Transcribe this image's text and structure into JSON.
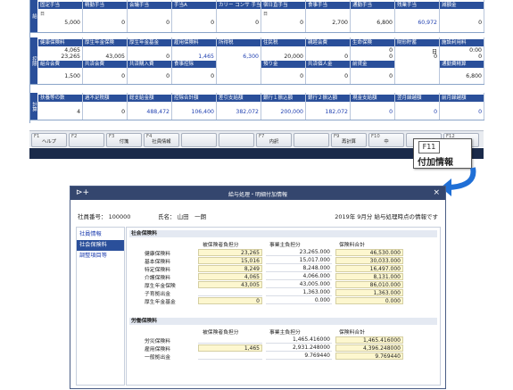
{
  "top_grid": {
    "row1": {
      "side": "給",
      "headers": [
        "固定手当",
        "精勤手当",
        "会議手当",
        "手当A",
        "カリー コンサ 手当",
        "宿日直手当",
        "食事手当",
        "通勤手当",
        "残業手当",
        "減額金"
      ],
      "marks": [
        "日",
        "",
        "",
        "",
        "",
        "日",
        "",
        "",
        "",
        ""
      ],
      "values": [
        "5,000",
        "0",
        "0",
        "0",
        "0",
        "0",
        "2,700",
        "6,800",
        "60,972",
        "0"
      ],
      "blue": [
        false,
        false,
        false,
        false,
        false,
        false,
        false,
        false,
        true,
        false
      ]
    },
    "row2": {
      "side": "控除",
      "headers": [
        "健康保険料",
        "厚生年金保険",
        "厚生年金基金",
        "雇用保険料",
        "所得税",
        "住民税",
        "親睦会費",
        "生命保険",
        "財形貯蓄",
        "施設利用料"
      ],
      "values_top": [
        "4,065",
        "",
        "",
        "",
        "",
        "",
        "",
        "0",
        "日",
        "0:00"
      ],
      "values": [
        "23,265",
        "43,005",
        "0",
        "1,465",
        "6,300",
        "20,000",
        "0",
        "0",
        "0",
        "0"
      ],
      "blue": [
        false,
        false,
        false,
        true,
        true,
        false,
        false,
        false,
        false,
        false
      ],
      "headers2": [
        "組合会費",
        "共済会費",
        "共済購入費",
        "食事控除",
        "",
        "預り金",
        "共済個人金",
        "前貸金",
        "",
        "通勤費精算"
      ],
      "values2": [
        "1,500",
        "0",
        "0",
        "0",
        "",
        "0",
        "0",
        "0",
        "",
        "6,800"
      ]
    },
    "row3": {
      "side": "計算",
      "headers": [
        "扶養等の数",
        "過不足税額",
        "総支給金額",
        "控除合計額",
        "差引支給額",
        "銀行１振込額",
        "銀行２振込額",
        "現金支給額",
        "翌月繰越額",
        "前月繰越額"
      ],
      "values": [
        "4",
        "0",
        "488,472",
        "106,400",
        "382,072",
        "200,000",
        "182,072",
        "0",
        "0",
        "0"
      ],
      "blue": [
        false,
        false,
        true,
        true,
        true,
        true,
        true,
        true,
        true,
        true
      ]
    }
  },
  "fkeys": [
    {
      "num": "F1",
      "label": "ヘルプ"
    },
    {
      "num": "F2",
      "label": ""
    },
    {
      "num": "F3",
      "label": "付箋"
    },
    {
      "num": "F4",
      "label": "社員情報"
    },
    {
      "num": "",
      "label": ""
    },
    {
      "num": "",
      "label": ""
    },
    {
      "num": "F7",
      "label": "内訳"
    },
    {
      "num": "",
      "label": ""
    },
    {
      "num": "F9",
      "label": "再計算"
    },
    {
      "num": "F10",
      "label": "中"
    },
    {
      "num": "",
      "label": ""
    },
    {
      "num": "F12",
      "label": "む"
    }
  ],
  "callout": {
    "key": "F11",
    "text": "付加情報"
  },
  "dialog": {
    "title": "給与処理・明細付加情報",
    "employee_no_label": "社員番号：",
    "employee_no": "100000",
    "name_label": "氏名：",
    "name": "山田　一朗",
    "period_note": "2019年 9月分 給与処理時点の情報です",
    "sidebar": [
      "社員情報",
      "社会保険料",
      "調整項目等"
    ],
    "social": {
      "title": "社会保険料",
      "cols": [
        "被保険者負担分",
        "事業主負担分",
        "保険料合計"
      ],
      "rows": [
        {
          "label": "健康保険料",
          "a": "23,265",
          "b": "23,265.000",
          "c": "46,530.000"
        },
        {
          "label": "基本保険料",
          "a": "15,016",
          "b": "15,017.000",
          "c": "30,033.000"
        },
        {
          "label": "特定保険料",
          "a": "8,249",
          "b": "8,248.000",
          "c": "16,497.000"
        },
        {
          "label": "介護保険料",
          "a": "4,065",
          "b": "4,066.000",
          "c": "8,131.000"
        },
        {
          "label": "厚生年金保険",
          "a": "43,005",
          "b": "43,005.000",
          "c": "86,010.000"
        },
        {
          "label": "子育拠出金",
          "a": "",
          "b": "1,363.000",
          "c": "1,363.000"
        },
        {
          "label": "厚生年金基金",
          "a": "0",
          "b": "0.000",
          "c": "0.000"
        }
      ]
    },
    "labor": {
      "title": "労働保険料",
      "cols": [
        "被保険者負担分",
        "事業主負担分",
        "保険料合計"
      ],
      "rows": [
        {
          "label": "労災保険料",
          "a": "",
          "b": "1,465.416000",
          "c": "1,465.416000"
        },
        {
          "label": "雇用保険料",
          "a": "1,465",
          "b": "2,931.248000",
          "c": "4,396.248000"
        },
        {
          "label": "一般拠出金",
          "a": "",
          "b": "9.769440",
          "c": "9.769440"
        }
      ]
    }
  }
}
